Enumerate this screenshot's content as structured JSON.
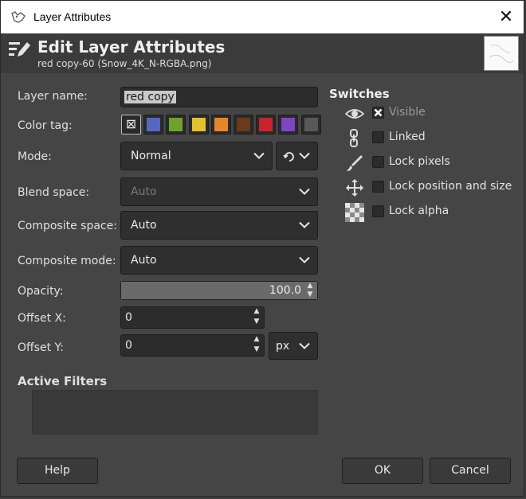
{
  "window": {
    "title": "Layer Attributes",
    "close_glyph": "✕"
  },
  "header": {
    "title": "Edit Layer Attributes",
    "subtitle": "red copy-60 (Snow_4K_N-RGBA.png)",
    "icon": "edit-layer-icon"
  },
  "form": {
    "layer_name_label": "Layer name:",
    "layer_name_value": "red copy",
    "color_tag_label": "Color tag:",
    "color_tags": [
      {
        "name": "none",
        "color": "#2a2a2a",
        "glyph": "⊠"
      },
      {
        "name": "blue",
        "color": "#5468c0"
      },
      {
        "name": "green",
        "color": "#6fa22a"
      },
      {
        "name": "yellow",
        "color": "#e3c12c"
      },
      {
        "name": "orange",
        "color": "#e8862a"
      },
      {
        "name": "brown",
        "color": "#6b3a1a"
      },
      {
        "name": "red",
        "color": "#c9232d"
      },
      {
        "name": "violet",
        "color": "#7e46c2"
      },
      {
        "name": "gray",
        "color": "#585858"
      }
    ],
    "mode_label": "Mode:",
    "mode_value": "Normal",
    "blend_space_label": "Blend space:",
    "blend_space_value": "Auto",
    "composite_space_label": "Composite space:",
    "composite_space_value": "Auto",
    "composite_mode_label": "Composite mode:",
    "composite_mode_value": "Auto",
    "opacity_label": "Opacity:",
    "opacity_value": "100.0",
    "offset_x_label": "Offset X:",
    "offset_x_value": "0",
    "offset_y_label": "Offset Y:",
    "offset_y_value": "0",
    "unit_value": "px",
    "active_filters_label": "Active Filters"
  },
  "switches": {
    "title": "Switches",
    "items": [
      {
        "label": "Visible",
        "icon": "eye-icon",
        "checked": true
      },
      {
        "label": "Linked",
        "icon": "chain-icon",
        "checked": false
      },
      {
        "label": "Lock pixels",
        "icon": "brush-icon",
        "checked": false
      },
      {
        "label": "Lock position and size",
        "icon": "move-icon",
        "checked": false
      },
      {
        "label": "Lock alpha",
        "icon": "checker-icon",
        "checked": false
      }
    ]
  },
  "buttons": {
    "help": "Help",
    "ok": "OK",
    "cancel": "Cancel"
  }
}
